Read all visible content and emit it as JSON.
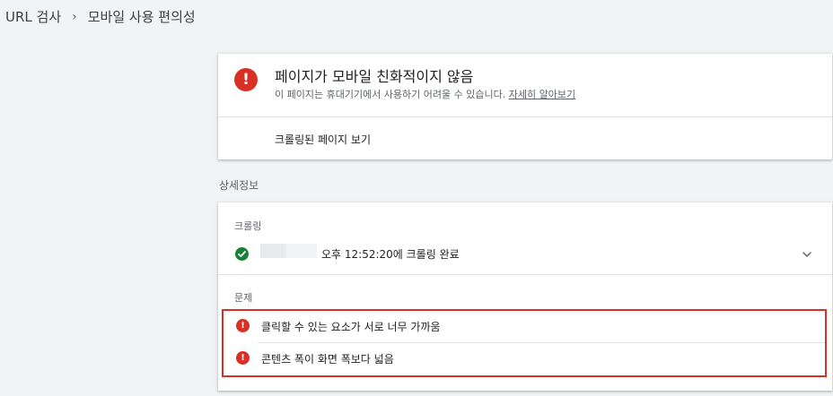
{
  "breadcrumb": {
    "root": "URL 검사",
    "separator": "›",
    "current": "모바일 사용 편의성"
  },
  "status": {
    "icon": "error-icon",
    "title": "페이지가 모바일 친화적이지 않음",
    "subtitle": "이 페이지는 휴대기기에서 사용하기 어려울 수 있습니다.",
    "learn_more": "자세히 알아보기",
    "view_crawled": "크롤링된 페이지 보기"
  },
  "details": {
    "heading": "상세정보",
    "crawl_label": "크롤링",
    "crawl_text": "오후 12:52:20에 크롤링 완료",
    "issues_label": "문제",
    "issues": [
      "클릭할 수 있는 요소가 서로 너무 가까움",
      "콘텐츠 폭이 화면 폭보다 넓음"
    ]
  },
  "colors": {
    "error": "#d93025",
    "success": "#188038",
    "background": "#f1f3f4"
  }
}
